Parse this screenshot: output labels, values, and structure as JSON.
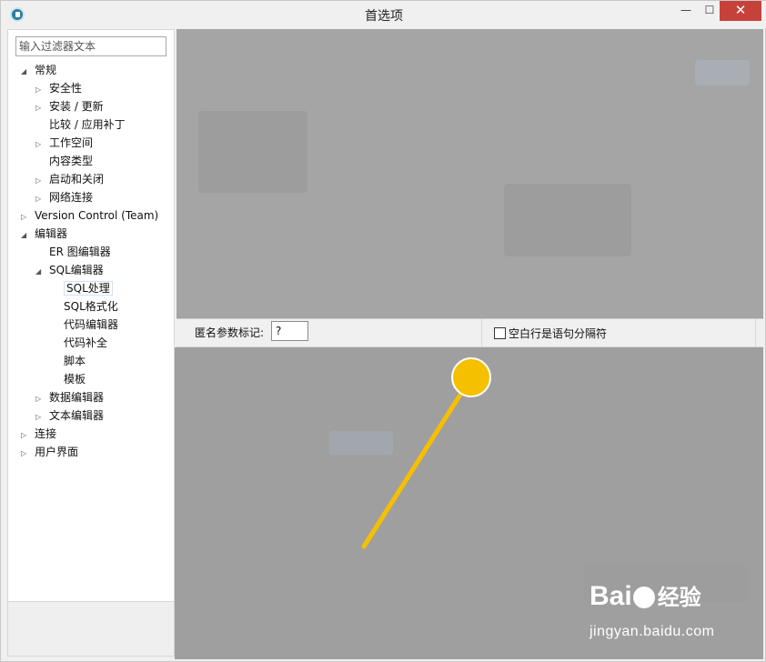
{
  "window": {
    "title": "首选项",
    "minimize_label": "—",
    "maximize_label": "☐",
    "close_label": "✕"
  },
  "filter": {
    "placeholder": "输入过滤器文本"
  },
  "tree": [
    {
      "label": "常规",
      "arrow": "◢"
    },
    {
      "label": "安全性",
      "arrow": "▷"
    },
    {
      "label": "安装 / 更新",
      "arrow": "▷"
    },
    {
      "label": "比较 / 应用补丁",
      "arrow": ""
    },
    {
      "label": "工作空间",
      "arrow": "▷"
    },
    {
      "label": "内容类型",
      "arrow": ""
    },
    {
      "label": "启动和关闭",
      "arrow": "▷"
    },
    {
      "label": "网络连接",
      "arrow": "▷"
    },
    {
      "label": "Version Control (Team)",
      "arrow": "▷"
    },
    {
      "label": "编辑器",
      "arrow": "◢"
    },
    {
      "label": "ER 图编辑器",
      "arrow": ""
    },
    {
      "label": "SQL编辑器",
      "arrow": "◢"
    },
    {
      "label": "SQL处理",
      "arrow": ""
    },
    {
      "label": "SQL格式化",
      "arrow": ""
    },
    {
      "label": "代码编辑器",
      "arrow": ""
    },
    {
      "label": "代码补全",
      "arrow": ""
    },
    {
      "label": "脚本",
      "arrow": ""
    },
    {
      "label": "模板",
      "arrow": ""
    },
    {
      "label": "数据编辑器",
      "arrow": "▷"
    },
    {
      "label": "文本编辑器",
      "arrow": "▷"
    },
    {
      "label": "连接",
      "arrow": "▷"
    },
    {
      "label": "用户界面",
      "arrow": "▷"
    }
  ],
  "settings": {
    "anon_param_label": "匿名参数标记:",
    "anon_param_value": "?",
    "blank_line_label": "空白行是语句分隔符",
    "blank_line_checked": false
  },
  "annotation": {
    "color": "#f5c000"
  },
  "watermark": {
    "brand_a": "Bai",
    "brand_b": "经验",
    "url": "jingyan.baidu.com"
  }
}
